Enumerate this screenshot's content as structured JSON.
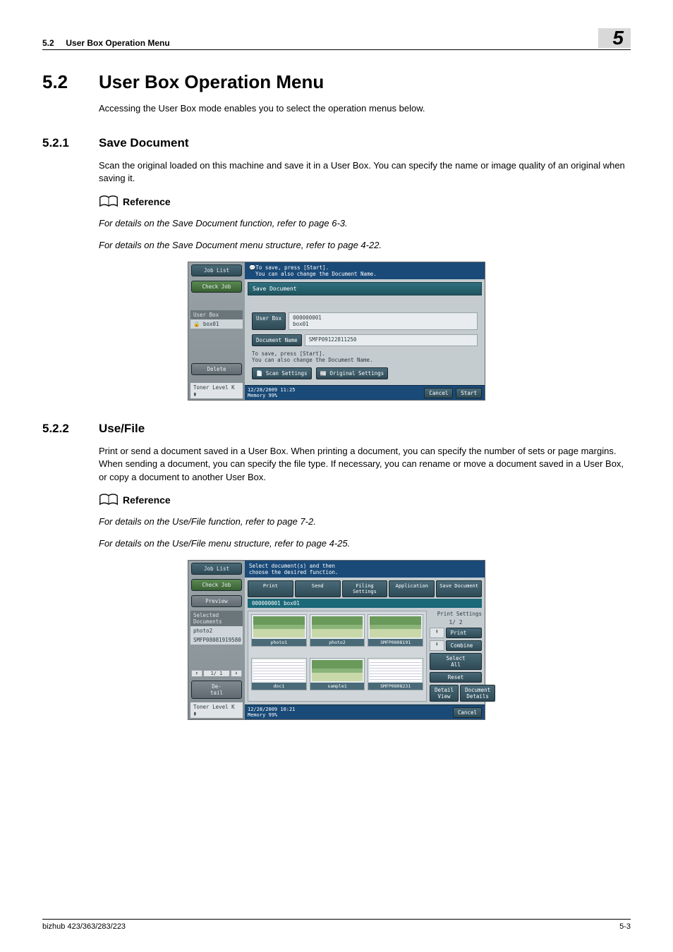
{
  "header": {
    "section_no": "5.2",
    "section_name": "User Box Operation Menu",
    "chapter_no": "5"
  },
  "s52": {
    "num": "5.2",
    "title": "User Box Operation Menu",
    "intro": "Accessing the User Box mode enables you to select the operation menus below."
  },
  "s521": {
    "num": "5.2.1",
    "title": "Save Document",
    "text": "Scan the original loaded on this machine and save it in a User Box. You can specify the name or image quality of an original when saving it.",
    "ref_label": "Reference",
    "ref1": "For details on the Save Document function, refer to page 6-3.",
    "ref2": "For details on the Save Document menu structure, refer to page 4-22."
  },
  "s522": {
    "num": "5.2.2",
    "title": "Use/File",
    "text": "Print or send a document saved in a User Box. When printing a document, you can specify the number of sets or page margins. When sending a document, you can specify the file type. If necessary, you can rename or move a document saved in a User Box, or copy a document to another User Box.",
    "ref_label": "Reference",
    "ref1": "For details on the Use/File function, refer to page 7-2.",
    "ref2": "For details on the Use/File menu structure, refer to page 4-25."
  },
  "screenshot1": {
    "hint1": "To save, press [Start].",
    "hint2": "You can also change the Document Name.",
    "job_list": "Job List",
    "check_job": "Check Job",
    "user_box_label": "User Box",
    "box_item": "box01",
    "delete": "Delete",
    "toner": "Toner Level K",
    "panel_title": "Save Document",
    "field_userbox": "User Box",
    "userbox_val_no": "000000001",
    "userbox_val_name": "box01",
    "field_docname": "Document Name",
    "docname_val": "SMFP09122811250",
    "note1": "To save, press [Start].",
    "note2": "You can also change the Document Name.",
    "scan_settings": "Scan Settings",
    "original_settings": "Original Settings",
    "datetime": "12/28/2009   11:25",
    "memory": "Memory      99%",
    "cancel": "Cancel",
    "start": "Start"
  },
  "screenshot2": {
    "hint1": "Select document(s) and then",
    "hint2": "choose the desired function.",
    "job_list": "Job List",
    "check_job": "Check Job",
    "preview": "Preview",
    "selected_docs": "Selected Documents",
    "sel1": "photo2",
    "sel2": "SMFP08081919580",
    "pager_left": "1/  1",
    "detail_btn": "De-\ntail",
    "toner": "Toner Level K",
    "tabs": [
      "Print",
      "Send",
      "Filing\nSettings",
      "Application",
      "Save Document"
    ],
    "crumb": "000000001  box01",
    "thumbs": [
      "photo1",
      "photo2",
      "SMFP0808191",
      "doc1",
      "sample1",
      "SMFP0808231"
    ],
    "pager_right": "1/  2",
    "print_settings": "Print Settings",
    "print": "Print",
    "combine": "Combine",
    "select_all": "Select\nAll",
    "reset": "Reset",
    "detail_view": "Detail\nView",
    "doc_details": "Document\nDetails",
    "datetime": "12/28/2009   10:21",
    "memory": "Memory      99%",
    "cancel": "Cancel"
  },
  "footer": {
    "left": "bizhub 423/363/283/223",
    "right": "5-3"
  }
}
